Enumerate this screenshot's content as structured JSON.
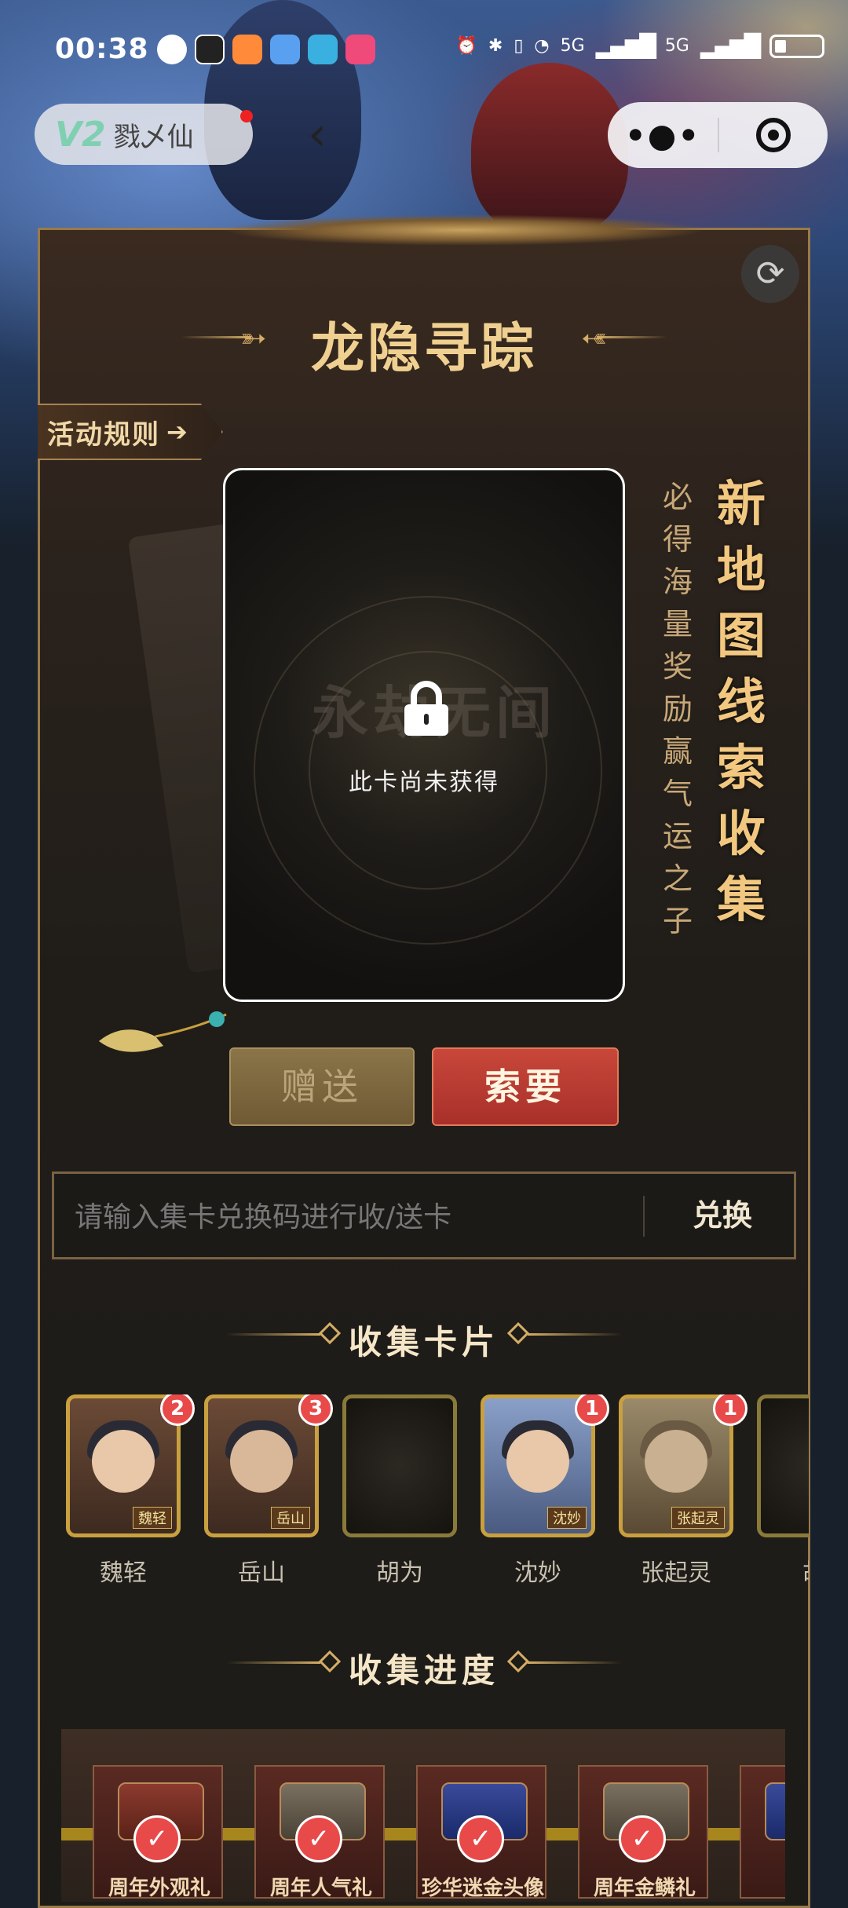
{
  "status_bar": {
    "time": "00:38",
    "signal_1": "5G",
    "signal_2": "5G"
  },
  "mini_program": {
    "logo": "V2",
    "app_name": "戮乄仙"
  },
  "page": {
    "title": "龙隐寻踪",
    "rules_label": "活动规则",
    "card_locked_text": "此卡尚未获得",
    "slogan_small": "必得海量奖励 赢气运之子",
    "slogan_big": "新地图线索收集",
    "give_label": "赠送",
    "ask_label": "索要",
    "code_placeholder": "请输入集卡兑换码进行收/送卡",
    "code_submit": "兑换",
    "section_collect_cards": "收集卡片",
    "section_progress": "收集进度"
  },
  "cards": [
    {
      "name": "魏轻",
      "badge": "2",
      "tag": "魏轻",
      "locked": false
    },
    {
      "name": "岳山",
      "badge": "3",
      "tag": "岳山",
      "locked": false
    },
    {
      "name": "胡为",
      "badge": "",
      "tag": "",
      "locked": true
    },
    {
      "name": "沈妙",
      "badge": "1",
      "tag": "沈妙",
      "locked": false
    },
    {
      "name": "张起灵",
      "badge": "1",
      "tag": "张起灵",
      "locked": false
    },
    {
      "name": "胡",
      "badge": "",
      "tag": "",
      "locked": true
    }
  ],
  "rewards": [
    {
      "label": "周年外观礼",
      "completed": true,
      "style": "red"
    },
    {
      "label": "周年人气礼",
      "completed": true,
      "style": "stone"
    },
    {
      "label": "珍华迷金头像",
      "completed": true,
      "style": "blue"
    },
    {
      "label": "周年金鳞礼",
      "completed": true,
      "style": "stone"
    },
    {
      "label": "周年",
      "completed": false,
      "style": "blue"
    }
  ],
  "colors": {
    "accent_gold": "#d4ad66",
    "ask_red": "#c8473a",
    "badge_red": "#e84a4a"
  }
}
